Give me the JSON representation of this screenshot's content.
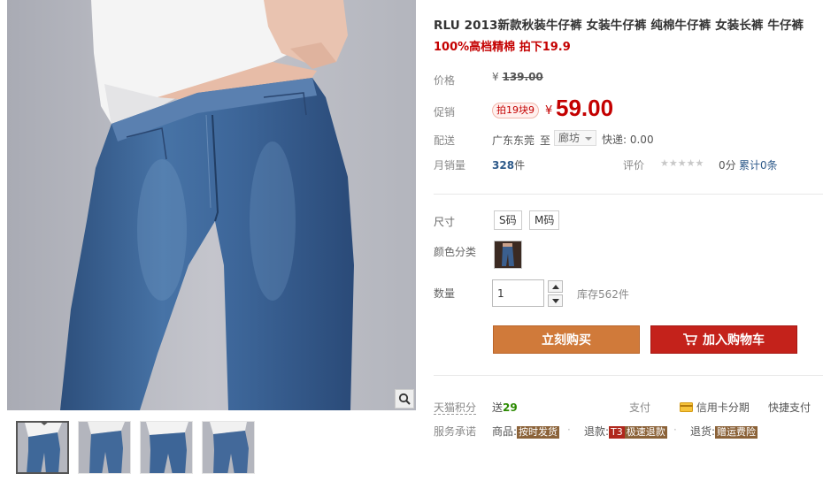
{
  "product": {
    "title": "RLU 2013新款秋装牛仔裤 女装牛仔裤 纯棉牛仔裤 女装长裤 牛仔裤",
    "subtitle": "100%高档精棉 拍下19.9"
  },
  "price": {
    "label": "价格",
    "currency": "¥",
    "original": "139.00"
  },
  "promo": {
    "label": "促销",
    "tag": "拍19块9",
    "currency": "¥",
    "price": "59.00"
  },
  "delivery": {
    "label": "配送",
    "from": "广东东莞",
    "to_word": "至",
    "destination": "廊坊",
    "shipping": "快递: 0.00"
  },
  "sales": {
    "label": "月销量",
    "count": "328",
    "unit": "件",
    "rating_label": "评价",
    "stars": "★★★★★",
    "score": "0分",
    "total_label": "累计0条"
  },
  "size": {
    "label": "尺寸",
    "options": [
      "S码",
      "M码"
    ]
  },
  "color": {
    "label": "颜色分类"
  },
  "quantity": {
    "label": "数量",
    "value": "1",
    "stock": "库存562件"
  },
  "actions": {
    "buy": "立刻购买",
    "cart": "加入购物车"
  },
  "points": {
    "label": "天猫积分",
    "text": "送",
    "value": "29"
  },
  "payment": {
    "label": "支付",
    "credit": "信用卡分期",
    "quick": "快捷支付"
  },
  "service": {
    "label": "服务承诺",
    "goods_label": "商品:",
    "goods_tag": "按时发货",
    "refund_label": "退款:",
    "refund_badge": "T3",
    "refund_tag": "极速退款",
    "return_label": "退货:",
    "return_tag": "赠运费险"
  },
  "colors": {
    "accent": "#c40000",
    "buy_button": "#d07a3a",
    "cart_button": "#c4221b",
    "points_green": "#2b8a00",
    "link_blue": "#2e5a8a"
  }
}
